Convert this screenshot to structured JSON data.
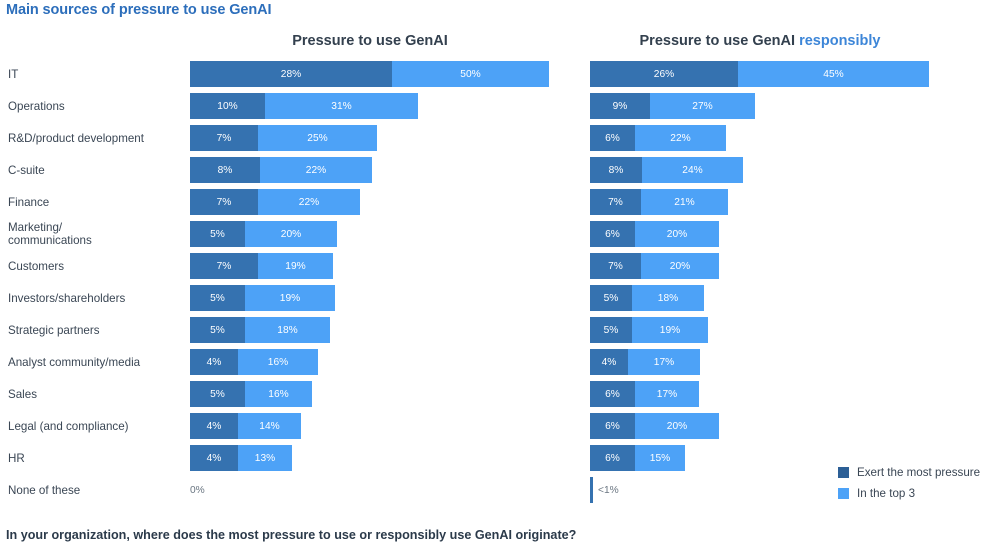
{
  "title": "Main sources of pressure to use GenAI",
  "columns": {
    "left": {
      "label": "Pressure to use GenAI"
    },
    "right": {
      "label_main": "Pressure to use GenAI ",
      "label_accent": "responsibly"
    }
  },
  "legend": {
    "items": [
      {
        "label": "Exert the most pressure",
        "color": "#2c5f96"
      },
      {
        "label": "In the top 3",
        "color": "#4da2f7"
      }
    ]
  },
  "footer": "In your organization, where does the most pressure to use or responsibly use GenAI originate?",
  "colors": {
    "series_a": "#3572b0",
    "series_b": "#4da2f7",
    "title": "#2c6ebb",
    "accent": "#3d86d8",
    "text": "#3a4654"
  },
  "chart_data": {
    "type": "bar",
    "title": "Main sources of pressure to use GenAI",
    "subtitle": "In your organization, where does the most pressure to use or responsibly use GenAI originate?",
    "xlabel": "",
    "ylabel": "",
    "orientation": "horizontal",
    "stacked": true,
    "grid": false,
    "legend_position": "bottom-right",
    "panels": [
      {
        "name": "Pressure to use GenAI",
        "categories": [
          "IT",
          "Operations",
          "R&D/product development",
          "C-suite",
          "Finance",
          "Marketing/\ncommunications",
          "Customers",
          "Investors/shareholders",
          "Strategic partners",
          "Analyst community/media",
          "Sales",
          "Legal (and compliance)",
          "HR",
          "None of these"
        ],
        "series": [
          {
            "name": "Exert the most pressure",
            "values": [
              28,
              10,
              7,
              8,
              7,
              5,
              7,
              5,
              5,
              4,
              5,
              4,
              4,
              0
            ]
          },
          {
            "name": "In the top 3",
            "values": [
              50,
              31,
              25,
              22,
              22,
              20,
              19,
              19,
              18,
              16,
              16,
              14,
              13,
              0
            ]
          }
        ]
      },
      {
        "name": "Pressure to use GenAI responsibly",
        "categories": [
          "IT",
          "Operations",
          "R&D/product development",
          "C-suite",
          "Finance",
          "Marketing/\ncommunications",
          "Customers",
          "Investors/shareholders",
          "Strategic partners",
          "Analyst community/media",
          "Sales",
          "Legal (and compliance)",
          "HR",
          "None of these"
        ],
        "series": [
          {
            "name": "Exert the most pressure",
            "values": [
              26,
              9,
              6,
              8,
              7,
              6,
              7,
              5,
              5,
              4,
              6,
              6,
              6,
              0
            ]
          },
          {
            "name": "In the top 3",
            "values": [
              45,
              27,
              22,
              24,
              21,
              20,
              20,
              18,
              19,
              17,
              17,
              20,
              15,
              0
            ]
          }
        ]
      }
    ]
  },
  "rows": [
    {
      "category": "IT",
      "two_line": false,
      "left": {
        "a_label": "28%",
        "b_label": "50%",
        "a_w": 202,
        "b_w": 157
      },
      "right": {
        "a_label": "26%",
        "b_label": "45%",
        "a_w": 148,
        "b_w": 191
      }
    },
    {
      "category": "Operations",
      "two_line": false,
      "left": {
        "a_label": "10%",
        "b_label": "31%",
        "a_w": 75,
        "b_w": 153
      },
      "right": {
        "a_label": "9%",
        "b_label": "27%",
        "a_w": 60,
        "b_w": 105
      }
    },
    {
      "category": "R&D/product development",
      "two_line": false,
      "left": {
        "a_label": "7%",
        "b_label": "25%",
        "a_w": 68,
        "b_w": 119
      },
      "right": {
        "a_label": "6%",
        "b_label": "22%",
        "a_w": 45,
        "b_w": 91
      }
    },
    {
      "category": "C-suite",
      "two_line": false,
      "left": {
        "a_label": "8%",
        "b_label": "22%",
        "a_w": 70,
        "b_w": 112
      },
      "right": {
        "a_label": "8%",
        "b_label": "24%",
        "a_w": 52,
        "b_w": 101
      }
    },
    {
      "category": "Finance",
      "two_line": false,
      "left": {
        "a_label": "7%",
        "b_label": "22%",
        "a_w": 68,
        "b_w": 102
      },
      "right": {
        "a_label": "7%",
        "b_label": "21%",
        "a_w": 51,
        "b_w": 87
      }
    },
    {
      "category": "Marketing/\ncommunications",
      "two_line": true,
      "left": {
        "a_label": "5%",
        "b_label": "20%",
        "a_w": 55,
        "b_w": 92
      },
      "right": {
        "a_label": "6%",
        "b_label": "20%",
        "a_w": 45,
        "b_w": 84
      }
    },
    {
      "category": "Customers",
      "two_line": false,
      "left": {
        "a_label": "7%",
        "b_label": "19%",
        "a_w": 68,
        "b_w": 75
      },
      "right": {
        "a_label": "7%",
        "b_label": "20%",
        "a_w": 51,
        "b_w": 78
      }
    },
    {
      "category": "Investors/shareholders",
      "two_line": false,
      "left": {
        "a_label": "5%",
        "b_label": "19%",
        "a_w": 55,
        "b_w": 90
      },
      "right": {
        "a_label": "5%",
        "b_label": "18%",
        "a_w": 42,
        "b_w": 72
      }
    },
    {
      "category": "Strategic partners",
      "two_line": false,
      "left": {
        "a_label": "5%",
        "b_label": "18%",
        "a_w": 55,
        "b_w": 85
      },
      "right": {
        "a_label": "5%",
        "b_label": "19%",
        "a_w": 42,
        "b_w": 76
      }
    },
    {
      "category": "Analyst community/media",
      "two_line": false,
      "left": {
        "a_label": "4%",
        "b_label": "16%",
        "a_w": 48,
        "b_w": 80
      },
      "right": {
        "a_label": "4%",
        "b_label": "17%",
        "a_w": 38,
        "b_w": 72
      }
    },
    {
      "category": "Sales",
      "two_line": false,
      "left": {
        "a_label": "5%",
        "b_label": "16%",
        "a_w": 55,
        "b_w": 67
      },
      "right": {
        "a_label": "6%",
        "b_label": "17%",
        "a_w": 45,
        "b_w": 64
      }
    },
    {
      "category": "Legal (and compliance)",
      "two_line": false,
      "left": {
        "a_label": "4%",
        "b_label": "14%",
        "a_w": 48,
        "b_w": 63
      },
      "right": {
        "a_label": "6%",
        "b_label": "20%",
        "a_w": 45,
        "b_w": 84
      }
    },
    {
      "category": "HR",
      "two_line": false,
      "left": {
        "a_label": "4%",
        "b_label": "13%",
        "a_w": 48,
        "b_w": 54
      },
      "right": {
        "a_label": "6%",
        "b_label": "15%",
        "a_w": 45,
        "b_w": 50
      }
    },
    {
      "category": "None of these",
      "two_line": false,
      "left": {
        "zero_label": "0%"
      },
      "right": {
        "tiny_label": "<1%"
      }
    }
  ]
}
